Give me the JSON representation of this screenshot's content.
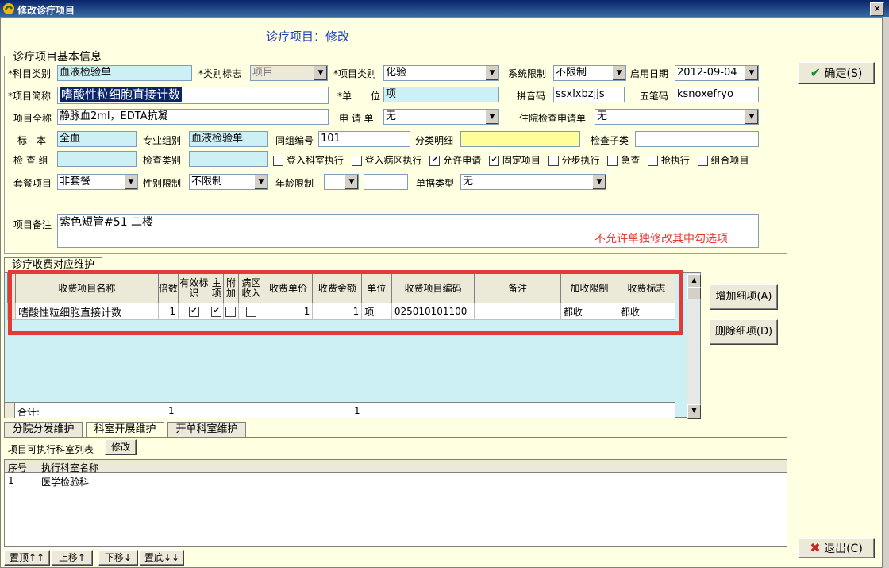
{
  "window": {
    "title": "修改诊疗项目"
  },
  "header": {
    "mode_title": "诊疗项目：修改"
  },
  "basic": {
    "legend": "诊疗项目基本信息",
    "subject_category_label": "*科目类别",
    "subject_category": "血液检验单",
    "category_flag_label": "*类别标志",
    "category_flag": "项目",
    "item_category_label": "*项目类别",
    "item_category": "化验",
    "system_limit_label": "系统限制",
    "system_limit": "不限制",
    "start_date_label": "启用日期",
    "start_date": "2012-09-04",
    "short_name_label": "*项目简称",
    "short_name": "嗜酸性粒细胞直接计数",
    "unit_label": "*单　　位",
    "unit": "项",
    "pinyin_label": "拼音码",
    "pinyin": "ssxlxbzjjs",
    "wubi_label": "五笔码",
    "wubi": "ksnoxefryo",
    "full_name_label": "项目全称",
    "full_name": "静脉血2ml，EDTA抗凝",
    "request_form_label": "申 请 单",
    "request_form": "无",
    "inpatient_form_label": "住院检查申请单",
    "inpatient_form": "无",
    "specimen_label": "标　本",
    "specimen": "全血",
    "prof_group_label": "专业组别",
    "prof_group": "血液检验单",
    "same_group_label": "同组编号",
    "same_group": "101",
    "class_detail_label": "分类明细",
    "class_detail": "",
    "exam_sub_label": "检查子类",
    "exam_sub": "",
    "exam_group_label": "检 查 组",
    "exam_group": "",
    "exam_type_label": "检查类别",
    "exam_type": "",
    "checks": [
      {
        "label": "登入科室执行",
        "checked": false
      },
      {
        "label": "登入病区执行",
        "checked": false
      },
      {
        "label": "允许申请",
        "checked": true
      },
      {
        "label": "固定项目",
        "checked": true
      },
      {
        "label": "分步执行",
        "checked": false
      },
      {
        "label": "急查",
        "checked": false
      },
      {
        "label": "抢执行",
        "checked": false
      },
      {
        "label": "组合项目",
        "checked": false
      }
    ],
    "package_label": "套餐项目",
    "package": "非套餐",
    "gender_label": "性别限制",
    "gender": "不限制",
    "age_label": "年龄限制",
    "age_from": "",
    "age_to": "",
    "doc_type_label": "单据类型",
    "doc_type": "无",
    "remark_label": "项目备注",
    "remark": "紫色短管#51 二楼",
    "warning": "不允许单独修改其中勾选项"
  },
  "fee": {
    "tab": "诊疗收费对应维护",
    "columns": [
      "收费项目名称",
      "倍数",
      "有效标识",
      "主项",
      "附加",
      "病区收入",
      "收费单价",
      "收费金额",
      "单位",
      "收费项目编码",
      "备注",
      "加收限制",
      "收费标志"
    ],
    "rows": [
      {
        "name": "嗜酸性粒细胞直接计数",
        "mult": "1",
        "valid": true,
        "main": true,
        "extra": false,
        "ward": false,
        "price": "1",
        "amount": "1",
        "unit": "项",
        "code": "025010101100",
        "note": "",
        "add_limit": "都收",
        "flag": "都收"
      }
    ],
    "total_label": "合计:",
    "total_mult": "1",
    "total_amount": "1",
    "add_btn": "增加细项(A)",
    "del_btn": "删除细项(D)"
  },
  "bottom": {
    "tabs": [
      "分院分发维护",
      "科室开展维护",
      "开单科室维护"
    ],
    "list_label": "项目可执行科室列表",
    "modify_btn": "修改",
    "columns": [
      "序号",
      "执行科室名称"
    ],
    "rows": [
      {
        "no": "1",
        "dept": "医学检验科"
      }
    ],
    "nav": [
      "置顶↑↑",
      "上移↑",
      "下移↓",
      "置底↓↓"
    ]
  },
  "actions": {
    "ok": "确定(S)",
    "exit": "退出(C)"
  },
  "colors": {
    "highlight_border": "#e53935",
    "grid_bg": "#cdf0f5",
    "warning": "#e53935"
  }
}
